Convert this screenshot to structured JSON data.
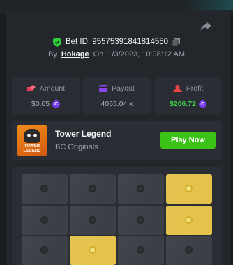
{
  "bet": {
    "id_label": "Bet ID: 95575391841814550",
    "by_label": "By",
    "user": "Hokage",
    "on_label": "On",
    "datetime": "1/3/2023, 10:08:12 AM"
  },
  "stats": [
    {
      "label": "Amount",
      "value": "$0.05",
      "icon": "amount-icon",
      "color": "#e3415a"
    },
    {
      "label": "Payout",
      "value": "4055.04 x",
      "icon": "payout-card-icon",
      "color": "#8a46f5"
    },
    {
      "label": "Profit",
      "value": "$206.72",
      "icon": "profit-icon",
      "color": "#e84444"
    }
  ],
  "game": {
    "title": "Tower Legend",
    "subtitle": "BC Originals",
    "play_label": "Play Now",
    "thumb_line1": "TOWER",
    "thumb_line2": "LEGEND"
  },
  "board": {
    "rows": [
      [
        "dark",
        "dark",
        "dark",
        "gold"
      ],
      [
        "dark",
        "dark",
        "dark",
        "gold"
      ],
      [
        "dark",
        "gold",
        "dark",
        "dark"
      ]
    ]
  },
  "colors": {
    "accent_green": "#3bc117",
    "profit_green": "#3fd14a",
    "coin_purple": "#7a3cf0",
    "gold_tile": "#e4c24c"
  }
}
